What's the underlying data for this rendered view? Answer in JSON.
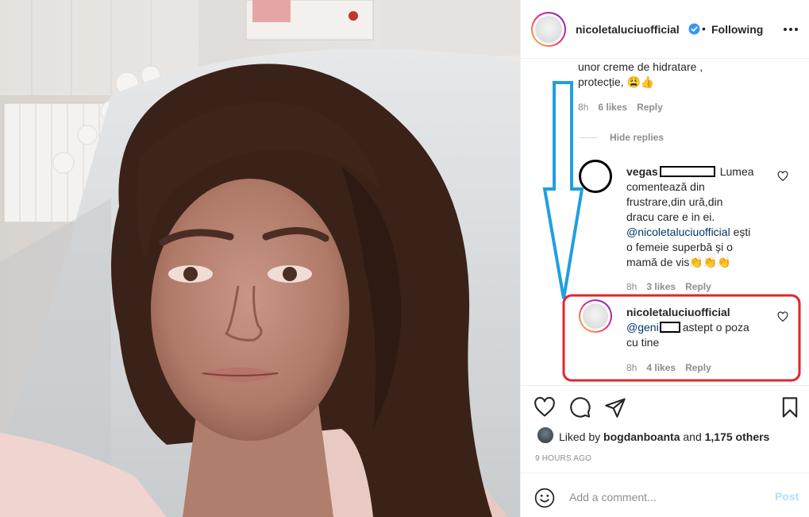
{
  "post": {
    "username": "nicoletaluciuofficial",
    "verified_icon": "verified-badge-icon",
    "separator": "•",
    "follow_status": "Following",
    "more_icon": "more-options-icon"
  },
  "comments": {
    "first": {
      "text_line1": "unor creme de hidratare ,",
      "text_line2": "protecție, 😩👍",
      "time": "8h",
      "likes": "6 likes",
      "reply": "Reply"
    },
    "hide_replies": "Hide replies",
    "reply1": {
      "username": "vegas",
      "line1": "Lumea",
      "line2": "comentează din",
      "line3": "frustrare,din ură,din",
      "line4": "dracu care e in ei.",
      "mention": "@nicoletaluciuofficial",
      "line5_rest": " ești",
      "line6": "o femeie superbă și o",
      "line7": "mamă de vis👏👏👏",
      "time": "8h",
      "likes": "3 likes",
      "reply": "Reply"
    },
    "reply2": {
      "username": "nicoletaluciuofficial",
      "mention": "@geni",
      "line1_rest": "astept o poza",
      "line2": "cu tine",
      "time": "8h",
      "likes": "4 likes",
      "reply": "Reply"
    }
  },
  "actions": {
    "like_icon": "heart-icon",
    "comment_icon": "comment-icon",
    "share_icon": "share-icon",
    "save_icon": "bookmark-icon",
    "liked_by_prefix": "Liked by",
    "liked_by_user": "bogdanboanta",
    "liked_by_and": "and",
    "liked_by_others": "1,175 others",
    "time_ago": "9 HOURS AGO",
    "emoji_icon": "emoji-icon",
    "comment_placeholder": "Add a comment...",
    "post_label": "Post"
  },
  "colors": {
    "annotation_blue": "#1fa0e0",
    "annotation_red": "#e0262b",
    "link": "#00376b",
    "muted": "#8e8e8e",
    "post_disabled": "#b2dffc"
  }
}
